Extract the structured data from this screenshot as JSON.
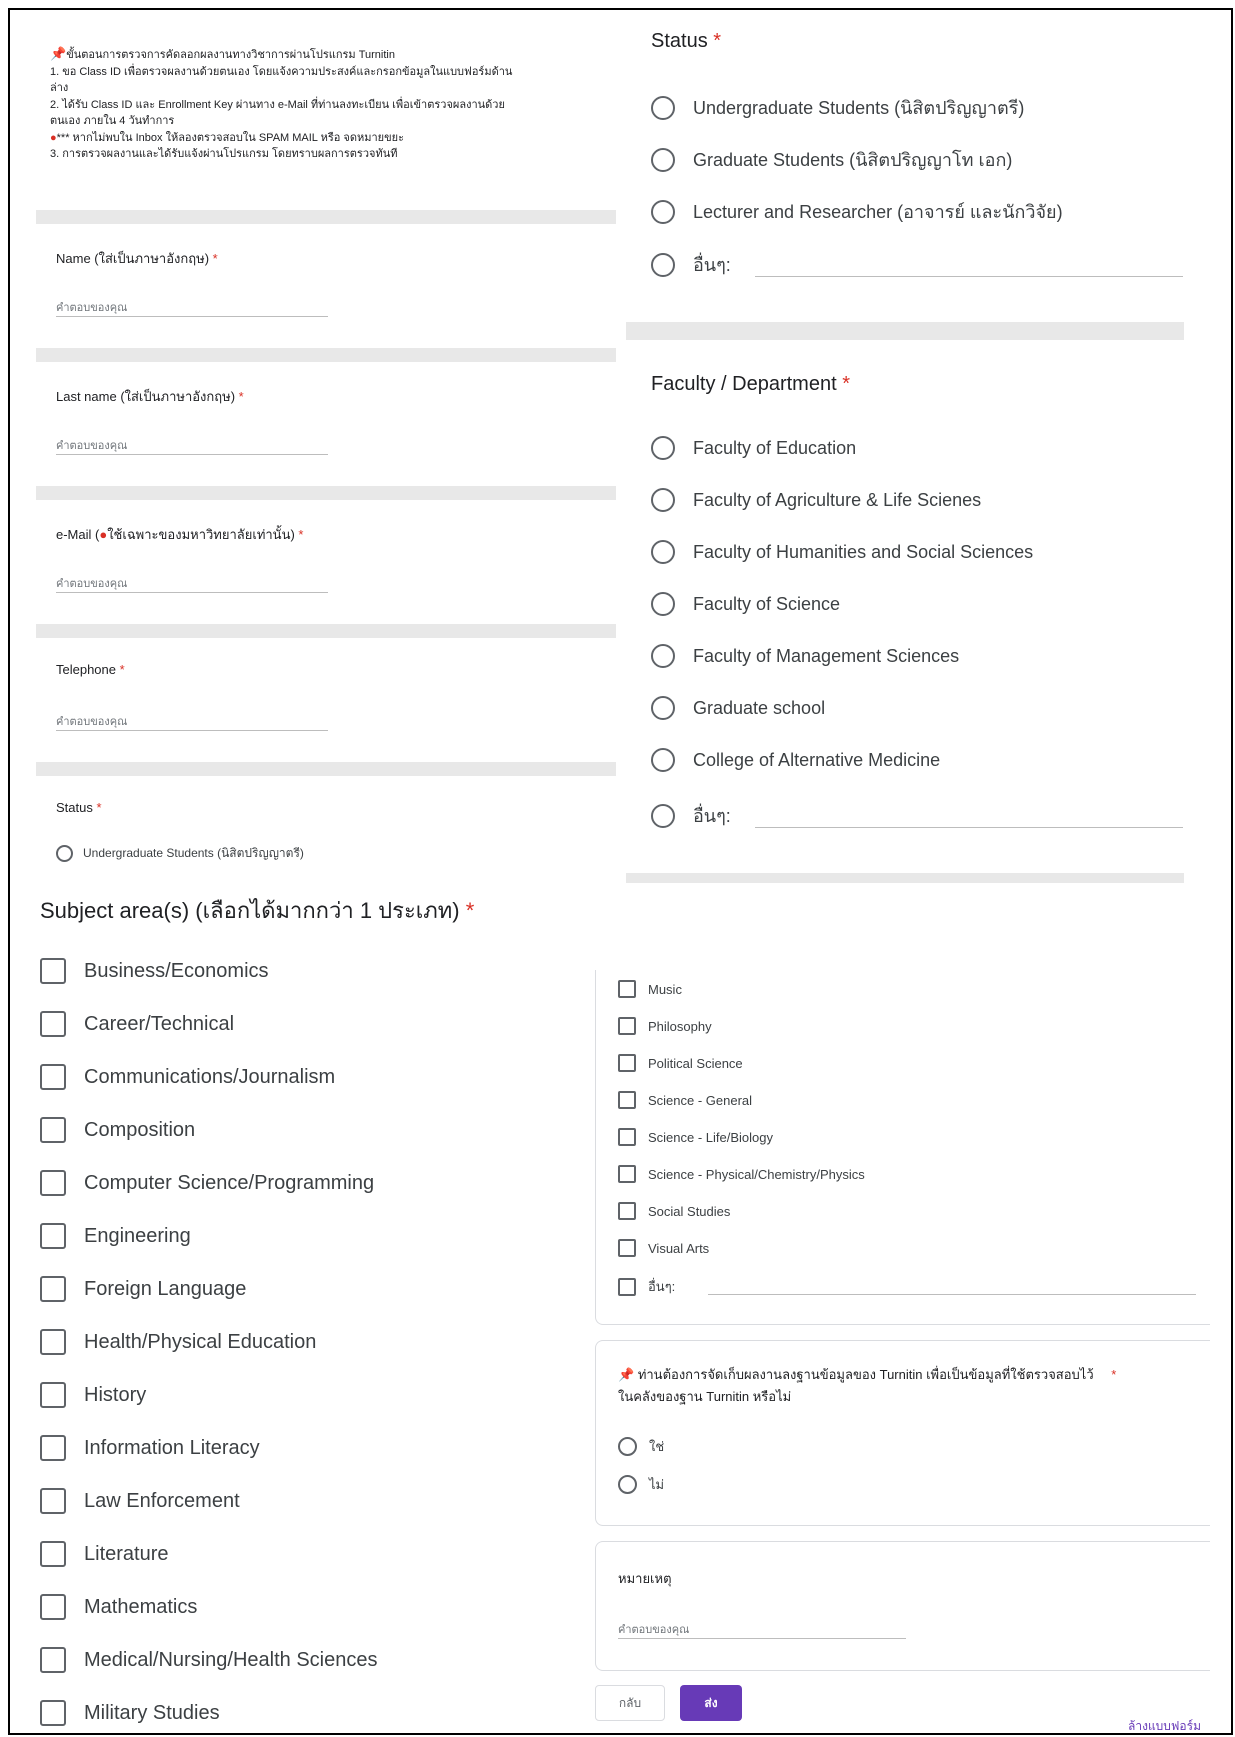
{
  "intro": {
    "pin_icon": "pushpin-icon",
    "lines": [
      "ขั้นตอนการตรวจการคัดลอกผลงานทางวิชาการผ่านโปรแกรม Turnitin",
      "1. ขอ Class ID เพื่อตรวจผลงานด้วยตนเอง โดยแจ้งความประสงค์และกรอกข้อมูลในแบบฟอร์มด้าน",
      "ล่าง",
      "2. ได้รับ Class ID และ Enrollment Key ผ่านทาง e-Mail ที่ท่านลงทะเบียน เพื่อเข้าตรวจผลงานด้วย",
      "ตนเอง ภายใน 4 วันทำการ",
      "*** หากไม่พบใน Inbox ให้ลองตรวจสอบใน SPAM MAIL หรือ จดหมายขยะ",
      "3. การตรวจผลงานและได้รับแจ้งผ่านโปรแกรม โดยทราบผลการตรวจทันที"
    ]
  },
  "fields": {
    "name_label": "Name (ใส่เป็นภาษาอังกฤษ)",
    "lastname_label": "Last name (ใส่เป็นภาษาอังกฤษ)",
    "email_label_pre": "e-Mail (",
    "email_label_post": "ใช้เฉพาะของมหาวิทยาลัยเท่านั้น)",
    "telephone_label": "Telephone",
    "status_label": "Status",
    "status_first_option": "Undergraduate Students (นิสิตปริญญาตรี)",
    "placeholder": "คำตอบของคุณ",
    "required_mark": "*"
  },
  "status_panel": {
    "title": "Status",
    "options": [
      "Undergraduate Students (นิสิตปริญญาตรี)",
      "Graduate Students (นิสิตปริญญาโท เอก)",
      "Lecturer and Researcher (อาจารย์ และนักวิจัย)",
      "อื่นๆ:"
    ]
  },
  "faculty_panel": {
    "title": "Faculty / Department",
    "options": [
      "Faculty of Education",
      "Faculty of Agriculture & Life Scienes",
      "Faculty of Humanities and Social Sciences",
      "Faculty of Science",
      "Faculty of Management Sciences",
      "Graduate school",
      "College of Alternative Medicine",
      "อื่นๆ:"
    ]
  },
  "subjects": {
    "title": "Subject area(s)  (เลือกได้มากกว่า 1 ประเภท)",
    "left": [
      "Business/Economics",
      "Career/Technical",
      "Communications/Journalism",
      "Composition",
      "Computer Science/Programming",
      "Engineering",
      "Foreign Language",
      "Health/Physical Education",
      "History",
      "Information Literacy",
      "Law Enforcement",
      "Literature",
      "Mathematics",
      "Medical/Nursing/Health Sciences",
      "Military Studies"
    ],
    "right": [
      "Music",
      "Philosophy",
      "Political Science",
      "Science - General",
      "Science - Life/Biology",
      "Science - Physical/Chemistry/Physics",
      "Social Studies",
      "Visual Arts",
      "อื่นๆ:"
    ]
  },
  "database_question": {
    "line1": "ท่านต้องการจัดเก็บผลงานลงฐานข้อมูลของ Turnitin เพื่อเป็นข้อมูลที่ใช้ตรวจสอบไว้",
    "line2": "ในคลังของฐาน Turnitin หรือไม่",
    "options": [
      "ใช่",
      "ไม่"
    ]
  },
  "note": {
    "label": "หมายเหตุ",
    "placeholder": "คำตอบของคุณ"
  },
  "buttons": {
    "back": "กลับ",
    "send": "ส่ง",
    "clear": "ล้างแบบฟอร์ม"
  },
  "colors": {
    "accent": "#673ab7",
    "required": "#d93025",
    "band": "#e8e8e8"
  }
}
